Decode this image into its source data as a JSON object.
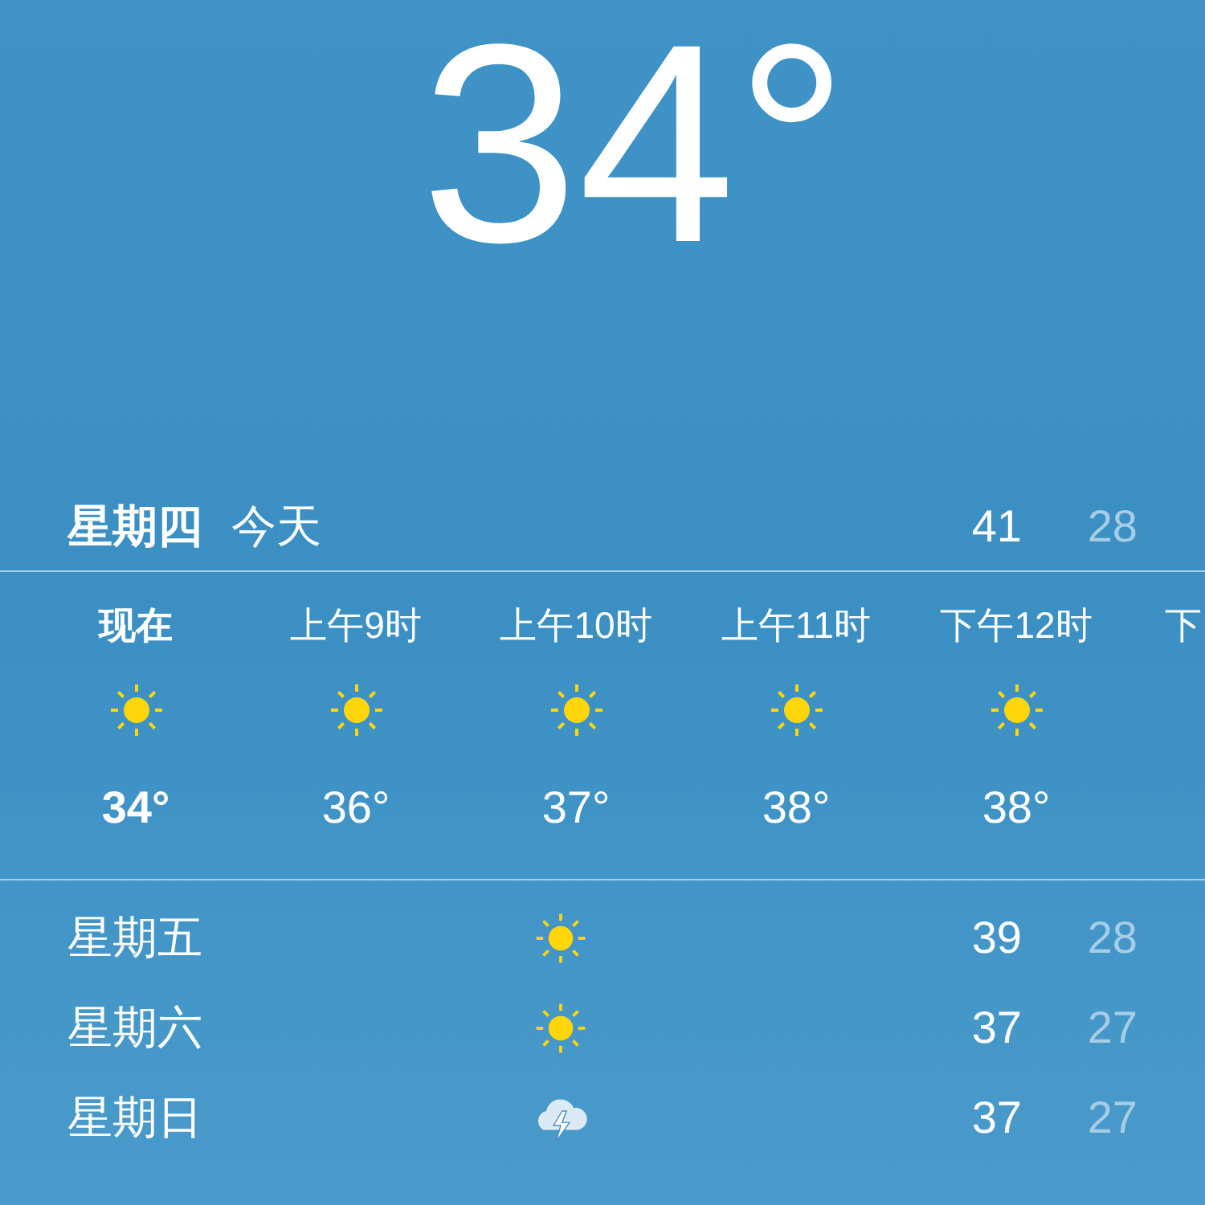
{
  "current": {
    "temperature": "34°"
  },
  "today": {
    "day": "星期四",
    "label": "今天",
    "high": "41",
    "low": "28"
  },
  "hourly": [
    {
      "time": "现在",
      "kind": "sunny",
      "temp": "34°",
      "current": true
    },
    {
      "time": "上午9时",
      "kind": "sunny",
      "temp": "36°",
      "current": false
    },
    {
      "time": "上午10时",
      "kind": "sunny",
      "temp": "37°",
      "current": false
    },
    {
      "time": "上午11时",
      "kind": "sunny",
      "temp": "38°",
      "current": false
    },
    {
      "time": "下午12时",
      "kind": "sunny",
      "temp": "38°",
      "current": false
    },
    {
      "time": "下",
      "current": false
    }
  ],
  "daily": [
    {
      "day": "星期五",
      "kind": "sunny",
      "high": "39",
      "low": "28"
    },
    {
      "day": "星期六",
      "kind": "sunny",
      "high": "37",
      "low": "27"
    },
    {
      "day": "星期日",
      "kind": "thunder",
      "high": "37",
      "low": "27"
    }
  ]
}
